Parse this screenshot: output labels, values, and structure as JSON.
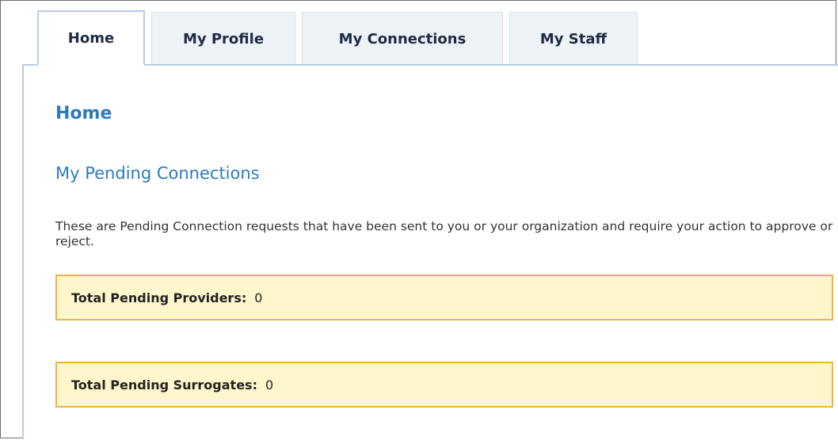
{
  "tabs": [
    {
      "label": "Home",
      "active": true
    },
    {
      "label": "My Profile",
      "active": false
    },
    {
      "label": "My Connections",
      "active": false
    },
    {
      "label": "My Staff",
      "active": false
    }
  ],
  "main": {
    "page_title": "Home",
    "section_title": "My Pending Connections",
    "description": "These are Pending Connection requests that have been sent to you or your organization and require your action to approve or reject.",
    "pending_providers": {
      "label": "Total Pending Providers:",
      "value": "0"
    },
    "pending_surrogates": {
      "label": "Total Pending Surrogates:",
      "value": "0"
    }
  },
  "colors": {
    "accent_blue": "#2b7bbd",
    "notice_background": "#fff6cc",
    "notice_border": "#f3b142",
    "tab_border": "#b7cde0"
  }
}
